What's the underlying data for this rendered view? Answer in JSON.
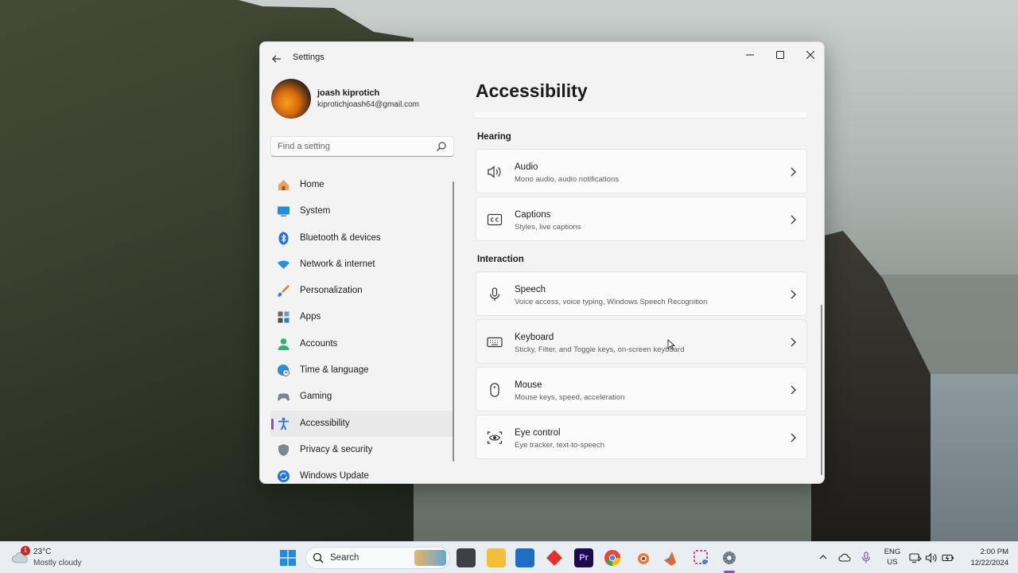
{
  "window": {
    "title": "Settings",
    "back_icon": "back-arrow-icon",
    "controls": [
      "minimize-icon",
      "maximize-icon",
      "close-icon"
    ]
  },
  "profile": {
    "name": "joash kiprotich",
    "email": "kiprotichjoash64@gmail.com"
  },
  "search": {
    "placeholder": "Find a setting",
    "icon": "search-icon"
  },
  "nav": {
    "active": "Accessibility",
    "items": [
      {
        "label": "Home",
        "icon": "home-icon"
      },
      {
        "label": "System",
        "icon": "monitor-icon"
      },
      {
        "label": "Bluetooth & devices",
        "icon": "bluetooth-icon"
      },
      {
        "label": "Network & internet",
        "icon": "wifi-icon"
      },
      {
        "label": "Personalization",
        "icon": "paintbrush-icon"
      },
      {
        "label": "Apps",
        "icon": "apps-icon"
      },
      {
        "label": "Accounts",
        "icon": "person-icon"
      },
      {
        "label": "Time & language",
        "icon": "globe-clock-icon"
      },
      {
        "label": "Gaming",
        "icon": "gamepad-icon"
      },
      {
        "label": "Accessibility",
        "icon": "accessibility-icon"
      },
      {
        "label": "Privacy & security",
        "icon": "shield-icon"
      },
      {
        "label": "Windows Update",
        "icon": "update-icon"
      }
    ]
  },
  "page": {
    "title": "Accessibility",
    "sections": [
      {
        "heading": "Hearing",
        "cards": [
          {
            "title": "Audio",
            "subtitle": "Mono audio, audio notifications",
            "icon": "speaker-icon"
          },
          {
            "title": "Captions",
            "subtitle": "Styles, live captions",
            "icon": "captions-icon"
          }
        ]
      },
      {
        "heading": "Interaction",
        "cards": [
          {
            "title": "Speech",
            "subtitle": "Voice access, voice typing, Windows Speech Recognition",
            "icon": "microphone-icon"
          },
          {
            "title": "Keyboard",
            "subtitle": "Sticky, Filter, and Toggle keys, on-screen keyboard",
            "icon": "keyboard-icon"
          },
          {
            "title": "Mouse",
            "subtitle": "Mouse keys, speed, acceleration",
            "icon": "mouse-icon"
          },
          {
            "title": "Eye control",
            "subtitle": "Eye tracker, text-to-speech",
            "icon": "eye-control-icon"
          }
        ]
      }
    ]
  },
  "taskbar": {
    "weather": {
      "badge": "1",
      "temp": "23°C",
      "desc": "Mostly cloudy",
      "icon": "cloudy-icon"
    },
    "search_label": "Search",
    "apps": [
      "file-explorer-icon",
      "folder-icon",
      "store-icon",
      "anydesk-icon",
      "premiere-icon",
      "chrome-icon",
      "blender-icon",
      "matlab-icon",
      "snipping-tool-icon",
      "settings-icon"
    ],
    "active_app": "settings-icon",
    "tray": {
      "lang_line1": "ENG",
      "lang_line2": "US"
    },
    "clock": {
      "time": "2:00 PM",
      "date": "12/22/2024"
    }
  },
  "colors": {
    "accent": "#8b4dc7",
    "window_bg": "#f3f3f3",
    "card_bg": "#fbfbfb"
  }
}
